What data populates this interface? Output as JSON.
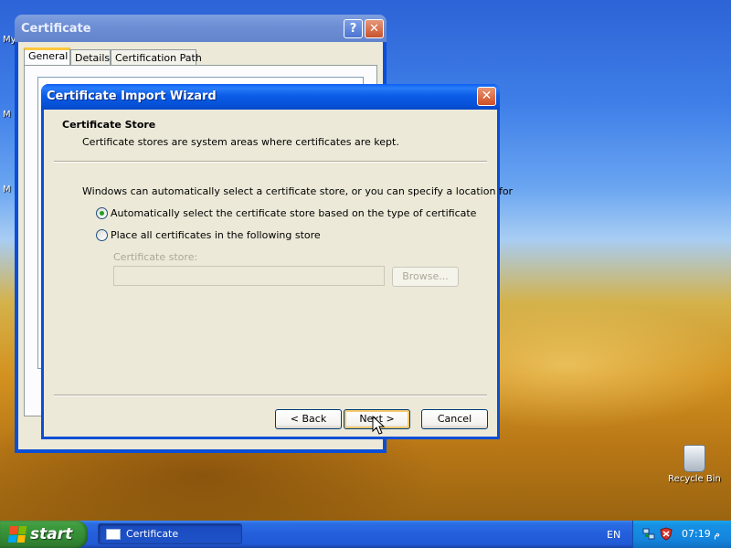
{
  "desktop": {
    "edge_letters": [
      "My",
      "M",
      "M"
    ],
    "recycle_bin_label": "Recycle Bin"
  },
  "certificate_window": {
    "title": "Certificate",
    "help_glyph": "?",
    "close_glyph": "✕",
    "tabs": [
      {
        "label": "General",
        "active": true
      },
      {
        "label": "Details",
        "active": false
      },
      {
        "label": "Certification Path",
        "active": false
      }
    ]
  },
  "wizard": {
    "title": "Certificate Import Wizard",
    "close_glyph": "✕",
    "header_title": "Certificate Store",
    "header_subtitle": "Certificate stores are system areas where certificates are kept.",
    "description": "Windows can automatically select a certificate store, or you can specify a location for",
    "options": [
      {
        "label": "Automatically select the certificate store based on the type of certificate",
        "checked": true
      },
      {
        "label": "Place all certificates in the following store",
        "checked": false
      }
    ],
    "store_label": "Certificate store:",
    "store_value": "",
    "browse_label": "Browse...",
    "back_label": "< Back",
    "next_label": "Next >",
    "cancel_label": "Cancel"
  },
  "taskbar": {
    "start_label": "start",
    "task_button_label": "Certificate",
    "language": "EN",
    "clock": "07:19 م"
  },
  "colors": {
    "titlebar_active": "#0a5ef4",
    "dialog_bg": "#ece9d8",
    "start_green": "#3c9a3c",
    "taskbar_blue": "#245edb",
    "radio_dot": "#21a121"
  }
}
